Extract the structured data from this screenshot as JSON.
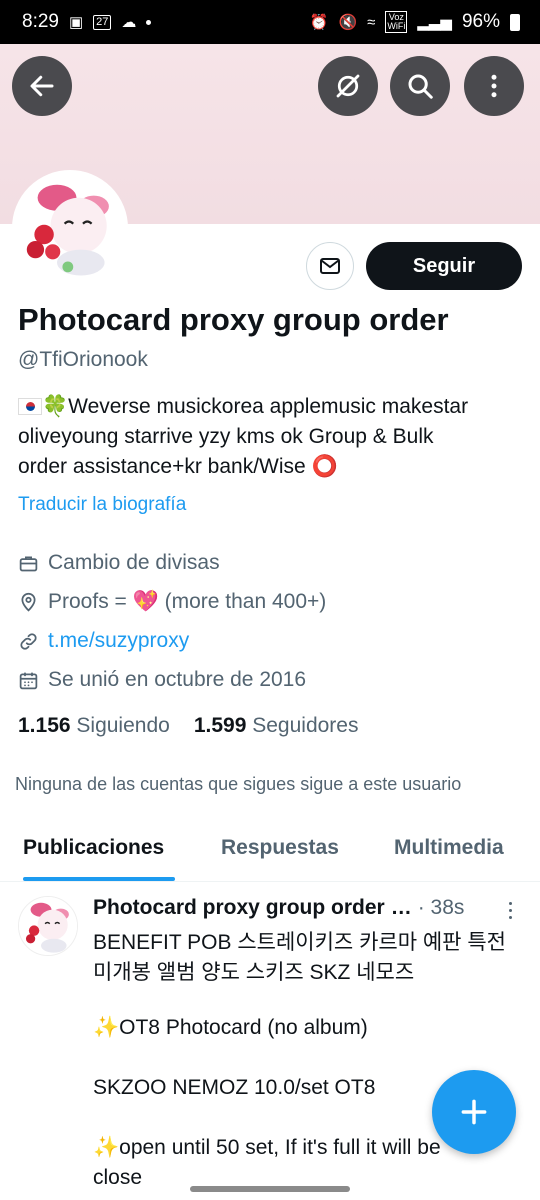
{
  "status_bar": {
    "time": "8:29",
    "calendar_day": "27",
    "battery": "96%",
    "network_label": "Voz WiFi"
  },
  "profile": {
    "name": "Photocard proxy group order",
    "handle": "@TfiOrionook",
    "bio_line1": "🍀Weverse musickorea applemusic makestar",
    "bio_line2": "oliveyoung starrive yzy kms ok Group & Bulk",
    "bio_line3": "order assistance+kr bank/Wise ⭕",
    "translate_label": "Traducir la biografía",
    "category": "Cambio de divisas",
    "location": "Proofs = 💖 (more than 400+)",
    "website": "t.me/suzyproxy",
    "joined": "Se unió en octubre de 2016",
    "following_count": "1.156",
    "following_label": "Siguiendo",
    "followers_count": "1.599",
    "followers_label": "Seguidores",
    "followed_by_note": "Ninguna de las cuentas que sigues sigue a este usuario"
  },
  "actions": {
    "follow_label": "Seguir"
  },
  "tabs": [
    {
      "label": "Publicaciones",
      "active": true
    },
    {
      "label": "Respuestas",
      "active": false
    },
    {
      "label": "Multimedia",
      "active": false
    }
  ],
  "post": {
    "author": "Photocard proxy group order",
    "time": "· 38s",
    "lines": [
      "BENEFIT POB 스트레이키즈 카르마 예판 특전",
      "미개봉 앨범 양도 스키즈 SKZ 네모즈",
      "✨OT8 Photocard (no album)",
      "SKZOO NEMOZ 10.0/set OT8",
      "✨open until 50 set, If it's full it will be",
      "close"
    ]
  },
  "icons": {
    "back": "arrow-left-icon",
    "grok": "grok-icon",
    "search": "search-icon",
    "more": "more-vertical-icon",
    "message": "mail-icon",
    "category": "briefcase-icon",
    "location": "location-pin-icon",
    "link": "link-icon",
    "calendar": "calendar-icon",
    "compose": "plus-icon"
  },
  "colors": {
    "accent": "#1d9bf0",
    "text": "#0f1419",
    "secondary": "#536471",
    "banner": "#f4e0e5"
  }
}
